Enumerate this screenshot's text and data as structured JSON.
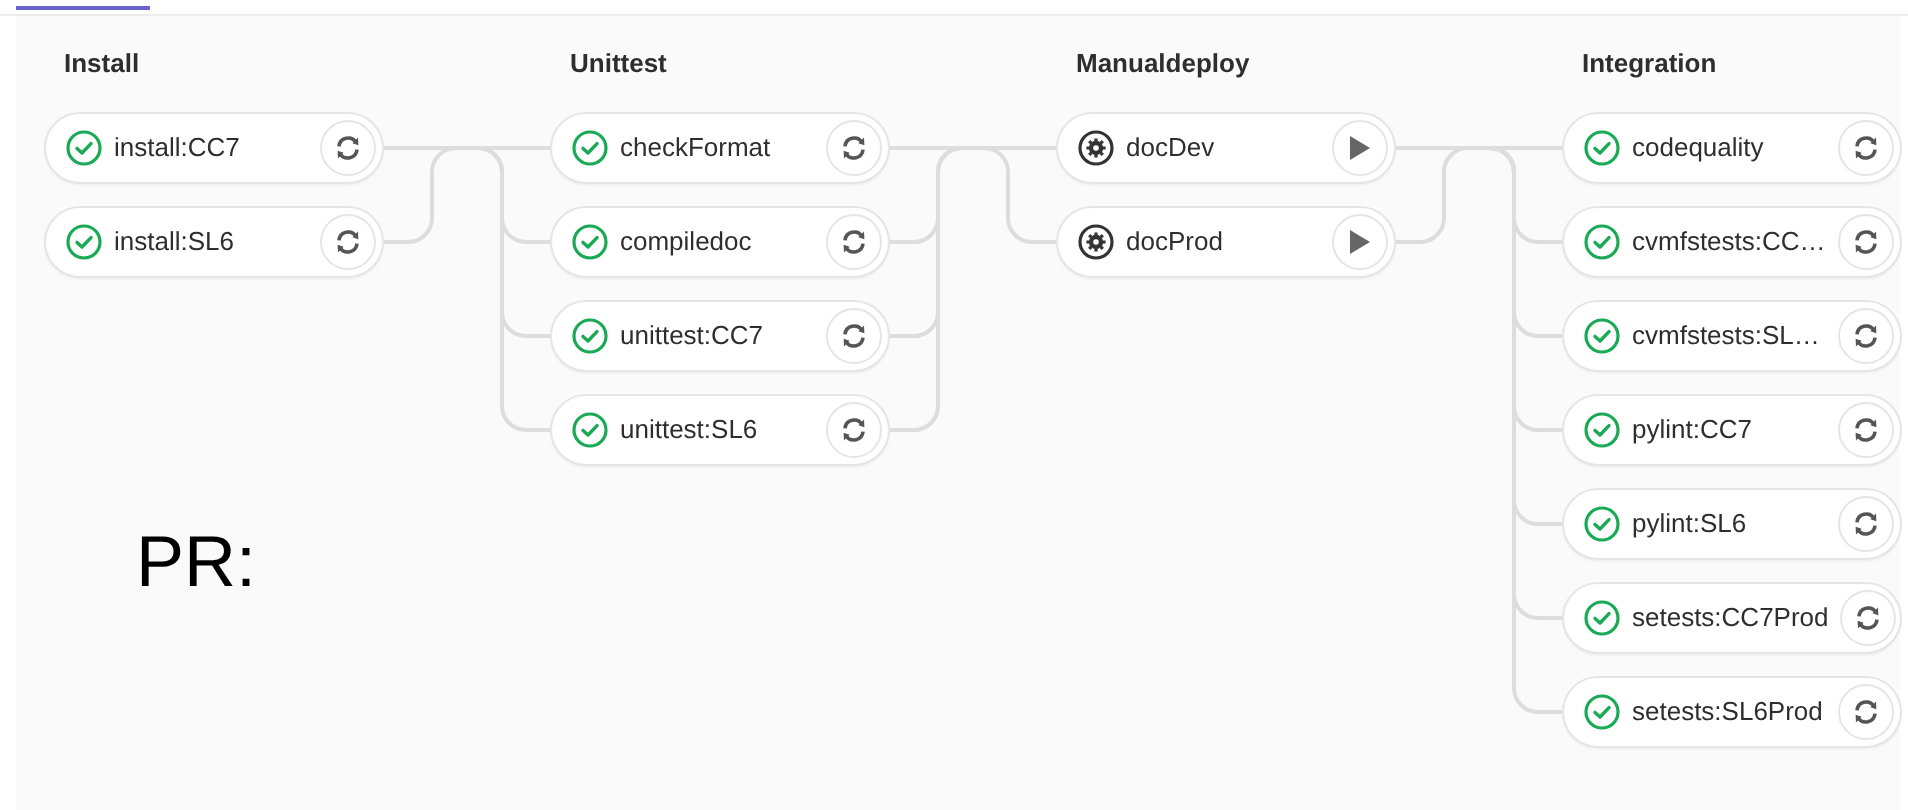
{
  "stages": [
    {
      "title": "Install",
      "jobs": [
        {
          "name": "install:CC7",
          "kind": "success",
          "action": {
            "kind": "retry"
          }
        },
        {
          "name": "install:SL6",
          "kind": "success",
          "action": {
            "kind": "retry"
          }
        }
      ]
    },
    {
      "title": "Unittest",
      "jobs": [
        {
          "name": "checkFormat",
          "kind": "success",
          "action": {
            "kind": "retry"
          }
        },
        {
          "name": "compiledoc",
          "kind": "success",
          "action": {
            "kind": "retry"
          }
        },
        {
          "name": "unittest:CC7",
          "kind": "success",
          "action": {
            "kind": "retry"
          }
        },
        {
          "name": "unittest:SL6",
          "kind": "success",
          "action": {
            "kind": "retry"
          }
        }
      ]
    },
    {
      "title": "Manualdeploy",
      "jobs": [
        {
          "name": "docDev",
          "kind": "manual",
          "action": {
            "kind": "play"
          }
        },
        {
          "name": "docProd",
          "kind": "manual",
          "action": {
            "kind": "play"
          }
        }
      ]
    },
    {
      "title": "Integration",
      "jobs": [
        {
          "name": "codequality",
          "kind": "success",
          "action": {
            "kind": "retry"
          }
        },
        {
          "name": "cvmfstests:CC…",
          "kind": "success",
          "action": {
            "kind": "retry"
          }
        },
        {
          "name": "cvmfstests:SL…",
          "kind": "success",
          "action": {
            "kind": "retry"
          }
        },
        {
          "name": "pylint:CC7",
          "kind": "success",
          "action": {
            "kind": "retry"
          }
        },
        {
          "name": "pylint:SL6",
          "kind": "success",
          "action": {
            "kind": "retry"
          }
        },
        {
          "name": "setests:CC7Prod",
          "kind": "success",
          "action": {
            "kind": "retry"
          }
        },
        {
          "name": "setests:SL6Prod",
          "kind": "success",
          "action": {
            "kind": "retry"
          }
        }
      ]
    }
  ],
  "annotation": "PR:"
}
